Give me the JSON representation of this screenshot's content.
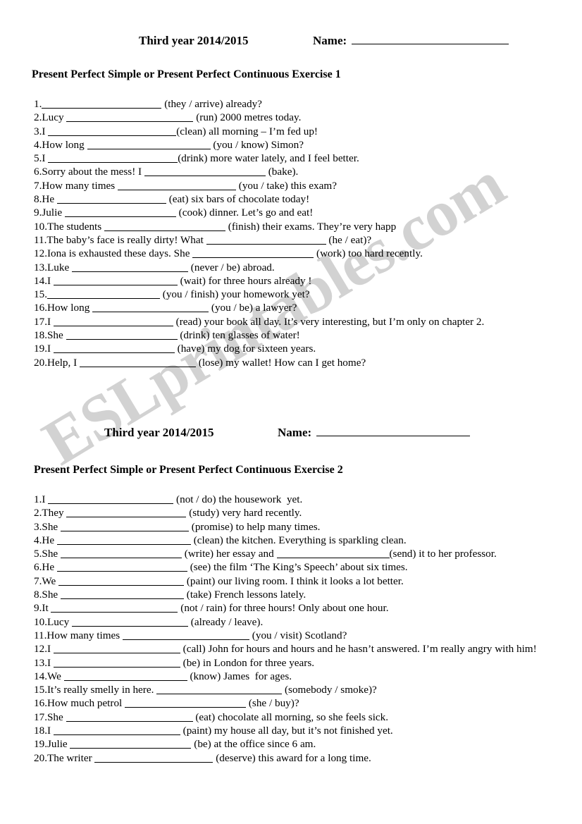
{
  "document": {
    "watermark": "ESLprintables.com",
    "watermark_color": "#d2d2d2",
    "text_color": "#000000",
    "background_color": "#ffffff"
  },
  "header1": {
    "term": "Third year 2014/2015",
    "name_label": "Name:"
  },
  "header2": {
    "term": "Third year 2014/2015",
    "name_label": "Name:"
  },
  "section1": {
    "title": "Present Perfect Simple or Present Perfect Continuous Exercise 1",
    "items": [
      {
        "num": "1.",
        "pre": "",
        "blank": 170,
        "post": " (they / arrive) already?"
      },
      {
        "num": "2.",
        "pre": "Lucy ",
        "blank": 180,
        "post": " (run) 2000 metres today."
      },
      {
        "num": "3.",
        "pre": "I ",
        "blank": 182,
        "post": "(clean) all morning – I’m fed up!"
      },
      {
        "num": "4.",
        "pre": "How long ",
        "blank": 175,
        "post": " (you / know) Simon?"
      },
      {
        "num": "5.",
        "pre": "I ",
        "blank": 184,
        "post": "(drink) more water lately, and I feel better."
      },
      {
        "num": "6.",
        "pre": "Sorry about the mess! I ",
        "blank": 172,
        "post": " (bake)."
      },
      {
        "num": "7.",
        "pre": "How many times ",
        "blank": 168,
        "post": " (you / take) this exam?"
      },
      {
        "num": "8.",
        "pre": "He ",
        "blank": 155,
        "post": " (eat) six bars of chocolate today!"
      },
      {
        "num": "9.",
        "pre": "Julie ",
        "blank": 158,
        "post": " (cook) dinner. Let’s go and eat!"
      },
      {
        "num": "10.",
        "pre": "The students ",
        "blank": 172,
        "post": " (finish) their exams. They’re very happ"
      },
      {
        "num": "11.",
        "pre": "The baby’s face is really dirty! What ",
        "blank": 170,
        "post": " (he / eat)?"
      },
      {
        "num": "12.",
        "pre": "Iona is exhausted these days. She ",
        "blank": 172,
        "post": " (work) too hard recently."
      },
      {
        "num": "13.",
        "pre": "Luke ",
        "blank": 165,
        "post": " (never / be) abroad."
      },
      {
        "num": "14.",
        "pre": "I ",
        "blank": 176,
        "post": " (wait) for three hours already !"
      },
      {
        "num": "15.",
        "pre": "",
        "blank": 160,
        "post": " (you / finish) your homework yet?"
      },
      {
        "num": "16.",
        "pre": "How long ",
        "blank": 165,
        "post": " (you / be) a lawyer?"
      },
      {
        "num": "17.",
        "pre": "I ",
        "blank": 170,
        "post": " (read) your book all day. It’s very interesting, but I’m only on chapter 2."
      },
      {
        "num": "18.",
        "pre": "She ",
        "blank": 158,
        "post": " (drink) ten glasses of water!"
      },
      {
        "num": "19.",
        "pre": "I ",
        "blank": 172,
        "post": " (have) my dog for sixteen years."
      },
      {
        "num": "20.",
        "pre": "Help, I ",
        "blank": 165,
        "post": " (lose) my wallet! How can I get home?"
      }
    ]
  },
  "section2": {
    "title": "Present Perfect Simple or Present Perfect Continuous Exercise 2",
    "items": [
      {
        "num": "1.",
        "pre": "I ",
        "blank": 178,
        "post": " (not / do) the housework  yet."
      },
      {
        "num": "2.",
        "pre": "They ",
        "blank": 170,
        "post": " (study) very hard recently."
      },
      {
        "num": "3.",
        "pre": "She ",
        "blank": 182,
        "post": " (promise) to help many times."
      },
      {
        "num": "4.",
        "pre": "He ",
        "blank": 190,
        "post": " (clean) the kitchen. Everything is sparkling clean."
      },
      {
        "num": "5.",
        "pre": "She ",
        "blank": 172,
        "post": " (write) her essay and ",
        "blank2": 160,
        "post2": "(send) it to her professor."
      },
      {
        "num": "6.",
        "pre": "He ",
        "blank": 185,
        "post": " (see) the film ‘The King’s Speech’ about six times."
      },
      {
        "num": "7.",
        "pre": "We ",
        "blank": 178,
        "post": " (paint) our living room. I think it looks a lot better."
      },
      {
        "num": "8.",
        "pre": "She ",
        "blank": 175,
        "post": " (take) French lessons lately."
      },
      {
        "num": "9.",
        "pre": "It ",
        "blank": 180,
        "post": " (not / rain) for three hours! Only about one hour."
      },
      {
        "num": "10.",
        "pre": "Lucy ",
        "blank": 165,
        "post": " (already / leave)."
      },
      {
        "num": "11.",
        "pre": "How many times ",
        "blank": 180,
        "post": " (you / visit) Scotland?"
      },
      {
        "num": "12.",
        "pre": "I ",
        "blank": 180,
        "post": " (call) John for hours and hours and he hasn’t answered. I’m really angry with him!"
      },
      {
        "num": "13.",
        "pre": "I ",
        "blank": 180,
        "post": " (be) in London for three years."
      },
      {
        "num": "14.",
        "pre": "We ",
        "blank": 175,
        "post": " (know) James  for ages."
      },
      {
        "num": "15.",
        "pre": "It’s really smelly in here. ",
        "blank": 178,
        "post": " (somebody / smoke)?"
      },
      {
        "num": "16.",
        "pre": "How much petrol ",
        "blank": 172,
        "post": " (she / buy)?"
      },
      {
        "num": "17.",
        "pre": "She ",
        "blank": 180,
        "post": " (eat) chocolate all morning, so she feels sick."
      },
      {
        "num": "18.",
        "pre": "I ",
        "blank": 180,
        "post": " (paint) my house all day, but it’s not finished yet."
      },
      {
        "num": "19.",
        "pre": "Julie ",
        "blank": 172,
        "post": " (be) at the office since 6 am."
      },
      {
        "num": "20.",
        "pre": "The writer ",
        "blank": 168,
        "post": " (deserve) this award for a long time."
      }
    ]
  }
}
